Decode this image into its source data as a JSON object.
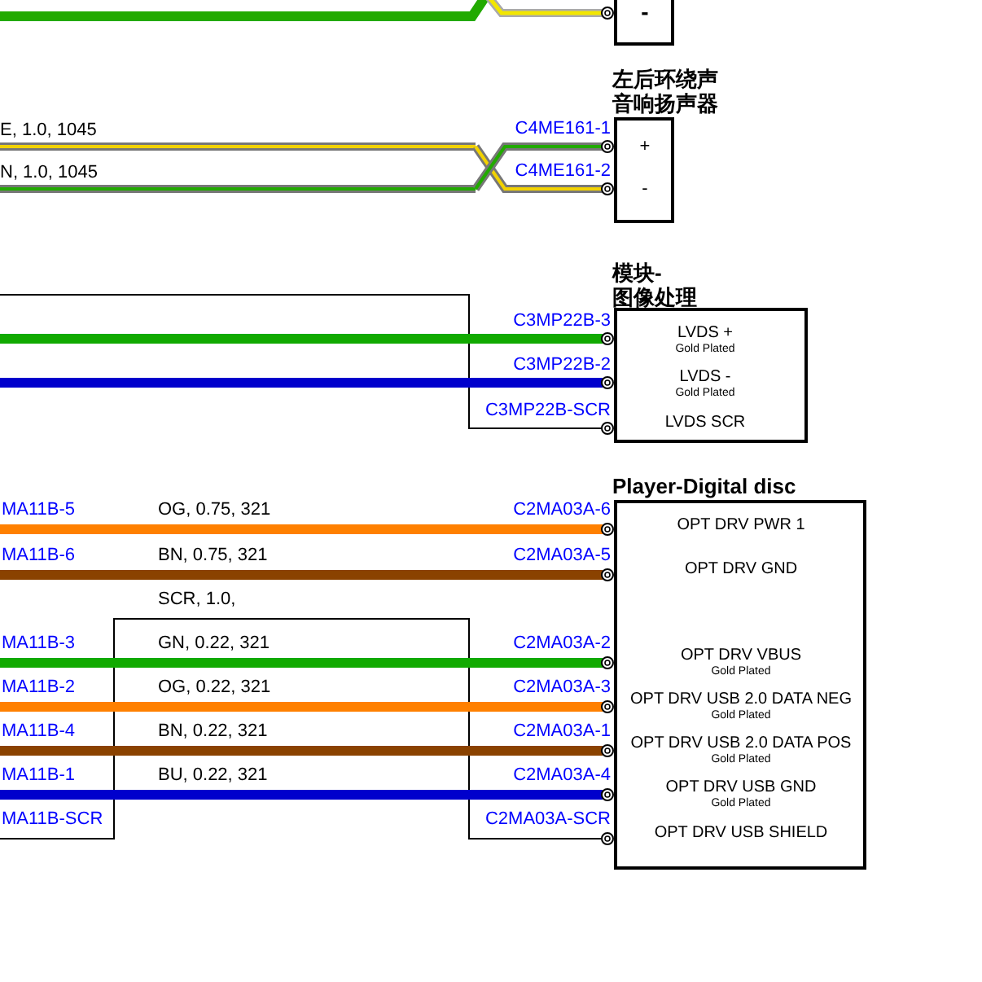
{
  "sections": [
    {
      "kind": "partial",
      "connector": {
        "pins": [
          {
            "name": "-"
          }
        ]
      },
      "wires": [
        {
          "color": "#22aa00",
          "bordered": false
        },
        {
          "color": "#f2e600",
          "bordered": true
        }
      ]
    },
    {
      "kind": "crossed",
      "connector": {
        "title": [
          "左后环绕声",
          "音响扬声器"
        ],
        "pins": [
          {
            "id": "C4ME161-1",
            "name": "+"
          },
          {
            "id": "C4ME161-2",
            "name": "-"
          }
        ]
      },
      "wires": [
        {
          "spec": "E, 1.0, 1045",
          "color": "#f2d200",
          "bordered": true
        },
        {
          "spec": "N, 1.0, 1045",
          "color": "#22aa00",
          "bordered": true
        }
      ]
    },
    {
      "kind": "shielded",
      "connector": {
        "title": [
          "模块-",
          "图像处理"
        ],
        "pins": [
          {
            "id": "C3MP22B-3",
            "name": "LVDS +",
            "note": "Gold Plated"
          },
          {
            "id": "C3MP22B-2",
            "name": "LVDS -",
            "note": "Gold Plated"
          },
          {
            "id": "C3MP22B-SCR",
            "name": "LVDS SCR"
          }
        ]
      },
      "wires": [
        {
          "color": "#11aa00",
          "bordered": false
        },
        {
          "color": "#0000cc",
          "bordered": false
        }
      ]
    },
    {
      "kind": "module",
      "connector": {
        "title": [
          "Player-Digital disc"
        ],
        "pins": [
          {
            "id": "C2MA03A-6",
            "name": "OPT DRV PWR 1"
          },
          {
            "id": "C2MA03A-5",
            "name": "OPT DRV GND"
          },
          {
            "id": "C2MA03A-2",
            "name": "OPT DRV VBUS",
            "note": "Gold Plated"
          },
          {
            "id": "C2MA03A-3",
            "name": "OPT DRV USB 2.0 DATA NEG",
            "note": "Gold Plated"
          },
          {
            "id": "C2MA03A-1",
            "name": "OPT DRV USB 2.0 DATA POS",
            "note": "Gold Plated"
          },
          {
            "id": "C2MA03A-4",
            "name": "OPT DRV USB GND",
            "note": "Gold Plated"
          },
          {
            "id": "C2MA03A-SCR",
            "name": "OPT DRV USB SHIELD"
          }
        ]
      },
      "wires": [
        {
          "from": "MA11B-5",
          "spec": "OG, 0.75, 321",
          "color": "#ff8000",
          "bordered": false
        },
        {
          "from": "MA11B-6",
          "spec": "BN, 0.75, 321",
          "color": "#8a4200",
          "bordered": false
        },
        {
          "spec": "SCR, 1.0,"
        },
        {
          "from": "MA11B-3",
          "spec": "GN, 0.22, 321",
          "color": "#11aa00",
          "bordered": false
        },
        {
          "from": "MA11B-2",
          "spec": "OG, 0.22, 321",
          "color": "#ff8000",
          "bordered": false
        },
        {
          "from": "MA11B-4",
          "spec": "BN, 0.22, 321",
          "color": "#8a4200",
          "bordered": false
        },
        {
          "from": "MA11B-1",
          "spec": "BU, 0.22, 321",
          "color": "#0000cc",
          "bordered": false
        },
        {
          "from": "MA11B-SCR"
        }
      ]
    }
  ]
}
